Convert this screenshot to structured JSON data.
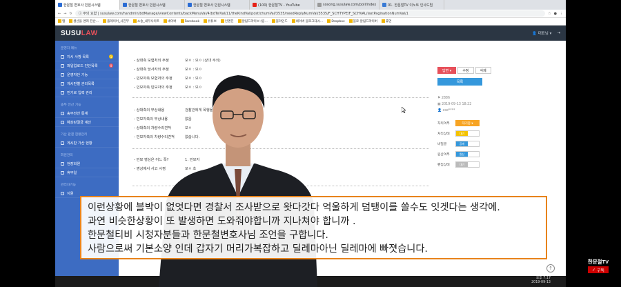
{
  "browser": {
    "tabs": [
      {
        "label": "한문철 변호사 민원시스템",
        "color": "#2b6cd4"
      },
      {
        "label": "한문철 변호사 민원시스템",
        "color": "#2b6cd4"
      },
      {
        "label": "한문철 변호사 민원시스템",
        "color": "#2b6cd4"
      },
      {
        "label": "(100) 한문철TV - YouTube",
        "color": "#e62117"
      },
      {
        "label": "sosong.susulaw.com/poll/index",
        "color": "#999999"
      },
      {
        "label": "01. 한문철TV 이노트 인사드립",
        "color": "#3a7bd5"
      }
    ],
    "address": "ⓘ 주의 요함 | susulaw.com/handmin/bdManage/viewContents/backMenuVal/4/bdTelVal/11/theKindVal/post/chumVal/3535/needReplyNumVal/3535/F_SCHTYPE/F_SCHVAL/lastPaginationNumVal/1",
    "bookmarks": [
      "앱",
      "생산을 앤리 전산...",
      "플레이어_사진부",
      "소송_내부사이트",
      "네이버",
      "Facebook",
      "유튜브",
      "인앤진",
      "알림드라이브 (링...",
      "블라인드",
      "네이버 블로그대시...",
      "Dropbox",
      "블로 알림드라이버",
      "휴먼"
    ]
  },
  "app": {
    "logo_main": "SUSU",
    "logo_accent": "LAW",
    "user": "👤 대표님 ▾",
    "logout_icon": "⇥"
  },
  "sidebar": {
    "section1": "운영자 메뉴",
    "items1": [
      {
        "label": "지시 사항 목록",
        "badge": "1",
        "badge_color": "#f3c200"
      },
      {
        "label": "파일업로드 진단목록",
        "badge": "0",
        "badge_color": "#e7505a"
      },
      {
        "label": "운영자단 기능",
        "badge": "",
        "badge_color": ""
      },
      {
        "label": "게시판별 관리목록",
        "badge": "",
        "badge_color": ""
      },
      {
        "label": "민기로 입력 관리",
        "badge": "",
        "badge_color": ""
      }
    ],
    "section2": "송무 전산 기능",
    "items2": [
      {
        "label": "송무전산 통계"
      },
      {
        "label": "예상판결금 계산"
      }
    ],
    "section3": "가산 판결 현황관리",
    "items3": [
      {
        "label": "게시판 가산 현황"
      }
    ],
    "section4": "회원관리",
    "items4": [
      {
        "label": "현장회원"
      },
      {
        "label": "휴무일"
      }
    ],
    "section5": "관리자기능",
    "items5": [
      {
        "label": "지원"
      }
    ]
  },
  "form": {
    "rows_a": [
      {
        "k": "- 상대측 보험처의 주정",
        "v": "모ㅇ : 모ㅇ (상대 주의)"
      },
      {
        "k": "- 상대측 당사자의 주정",
        "v": "모ㅇ : 모ㅇ"
      },
      {
        "k": "- 민모자측 보험처의 주정",
        "v": "모ㅇ : 모ㅇ"
      },
      {
        "k": "- 인모자측 민모자의 주정",
        "v": "모ㅇ : 모ㅇ"
      }
    ],
    "rows_b": [
      {
        "k": "- 상대측의 부상내용",
        "v": "검찰관에게 폭행을"
      },
      {
        "k": "- 민모자측의 부상내용",
        "v": "없음"
      },
      {
        "k": "- 상대측의 차량수리견적",
        "v": "모ㅇ"
      },
      {
        "k": "- 민모자측의 차량수리견적",
        "v": "없습니다."
      }
    ],
    "rows_c": [
      {
        "k": "- 민모 영상은 어느 쪽?",
        "v": "1. 민모자"
      },
      {
        "k": "- 영상에서 사고 시점",
        "v": "모ㅇ 초"
      }
    ]
  },
  "right": {
    "btn_reply": "답변 ▾",
    "btn_edit": "수정",
    "btn_delete": "삭제",
    "btn_main": "목록",
    "views": "2886",
    "date": "2019-09-13 18:22",
    "writer": "xse****",
    "status_label": "처리여부",
    "status_value": "대기중 ▾",
    "props": [
      {
        "k": "처리상태",
        "v": "대기",
        "color": "#f3c200"
      },
      {
        "k": "비밀글",
        "v": "공개",
        "color": "#3598dc"
      },
      {
        "k": "원산여부",
        "v": "원산",
        "color": "#3598dc"
      },
      {
        "k": "편집상태",
        "v": "대기",
        "color": "#bbbbbb"
      }
    ]
  },
  "subtitles": [
    "이런상황에 블박이 없엇다면 경찰서 조사받으로 왓다갓다 억울하게 덤탱이를 쓸수도 잇겟다는 생각에.",
    "과연 비슷한상황이 또 발생하면 도와줘야합니까 지나쳐야 합니까 .",
    "한문철티비 시청자분들과 한문철변호사님 조언을 구합니다.",
    "사람으로써 기본소양 인데 갑자기 머리가복잡하고 딜레마아닌 딜레마에 빠졋습니다."
  ],
  "clock": {
    "time": "오후 7:17",
    "date": "2019-09-13"
  },
  "channel": {
    "name": "한문철TV",
    "subscribe": "구독"
  },
  "colors": {
    "header": "#2b3643",
    "sidebar": "#3d6cc2",
    "subtitle_border": "#e8831b",
    "accent": "#e7505a"
  }
}
